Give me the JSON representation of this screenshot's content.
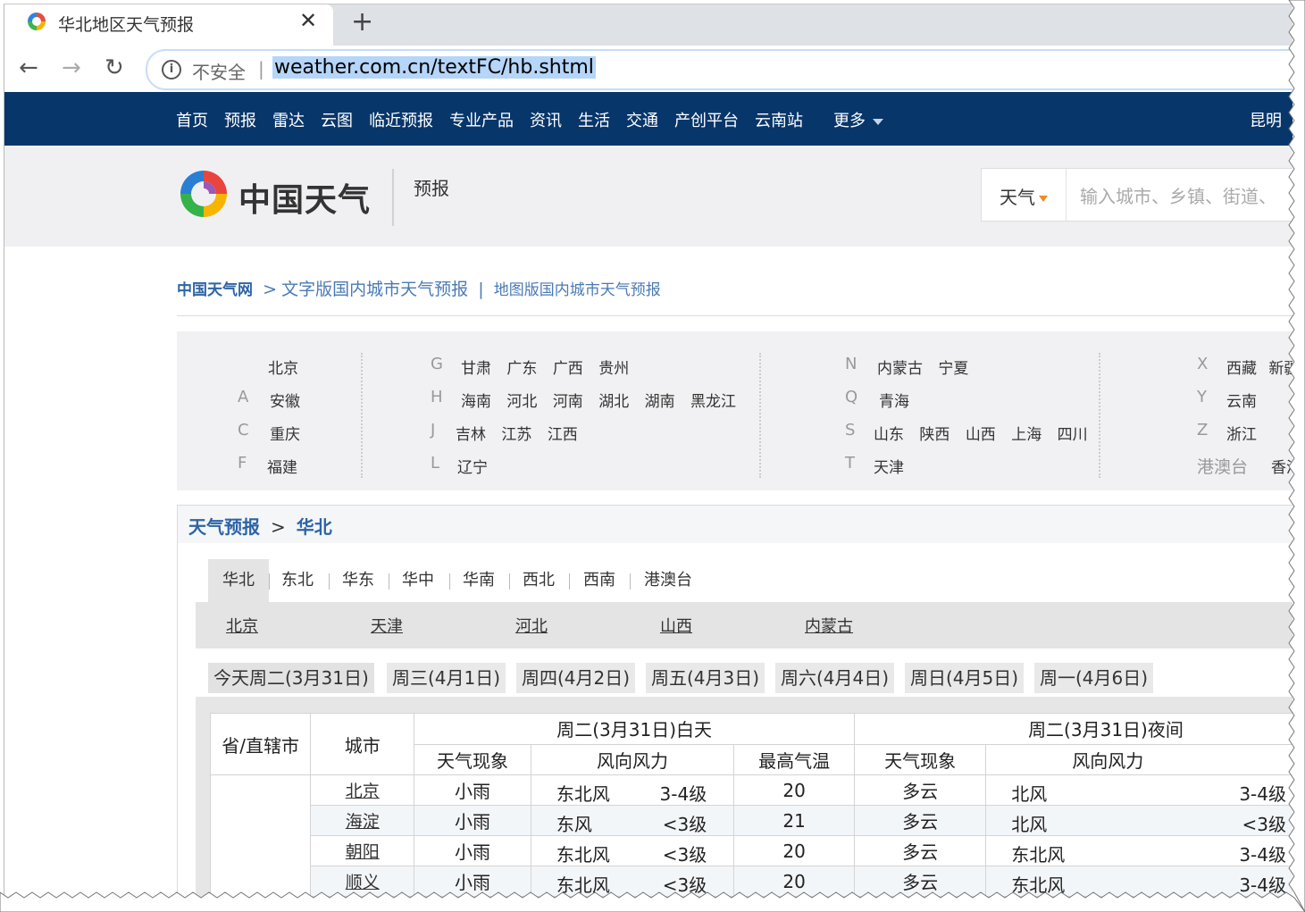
{
  "browser": {
    "tab_title": "华北地区天气预报",
    "close_glyph": "✕",
    "new_tab_glyph": "+",
    "back_glyph": "←",
    "forward_glyph": "→",
    "reload_glyph": "↻",
    "info_glyph": "i",
    "insecure_label": "不安全",
    "separator": "|",
    "url": "weather.com.cn/textFC/hb.shtml"
  },
  "sitenav": {
    "items": [
      "首页",
      "预报",
      "雷达",
      "云图",
      "临近预报",
      "专业产品",
      "资讯",
      "生活",
      "交通",
      "产创平台",
      "云南站"
    ],
    "more": "更多",
    "city": "昆明"
  },
  "header": {
    "logo_text": "中国天气",
    "section": "预报",
    "search_type": "天气",
    "search_placeholder": "输入城市、乡镇、街道、"
  },
  "breadcrumb": {
    "home": "中国天气网",
    "arrow": ">",
    "current": "文字版国内城市天气预报",
    "divider": "|",
    "alt": "地图版国内城市天气预报"
  },
  "provinces": {
    "col1": [
      {
        "letter": "",
        "names": [
          "北京"
        ]
      },
      {
        "letter": "A",
        "names": [
          "安徽"
        ]
      },
      {
        "letter": "C",
        "names": [
          "重庆"
        ]
      },
      {
        "letter": "F",
        "names": [
          "福建"
        ]
      }
    ],
    "col2": [
      {
        "letter": "G",
        "names": [
          "甘肃",
          "广东",
          "广西",
          "贵州"
        ]
      },
      {
        "letter": "H",
        "names": [
          "海南",
          "河北",
          "河南",
          "湖北",
          "湖南",
          "黑龙江"
        ]
      },
      {
        "letter": "J",
        "names": [
          "吉林",
          "江苏",
          "江西"
        ]
      },
      {
        "letter": "L",
        "names": [
          "辽宁"
        ]
      }
    ],
    "col3": [
      {
        "letter": "N",
        "names": [
          "内蒙古",
          "宁夏"
        ]
      },
      {
        "letter": "Q",
        "names": [
          "青海"
        ]
      },
      {
        "letter": "S",
        "names": [
          "山东",
          "陕西",
          "山西",
          "上海",
          "四川"
        ]
      },
      {
        "letter": "T",
        "names": [
          "天津"
        ]
      }
    ],
    "col4": [
      {
        "letter": "X",
        "names": [
          "西藏",
          "新疆"
        ]
      },
      {
        "letter": "Y",
        "names": [
          "云南"
        ]
      },
      {
        "letter": "Z",
        "names": [
          "浙江"
        ]
      },
      {
        "letter": "港澳台",
        "names": [
          "香港"
        ]
      }
    ]
  },
  "forecast": {
    "title": "天气预报",
    "title_sep": ">",
    "title_region": "华北",
    "regions": [
      "华北",
      "东北",
      "华东",
      "华中",
      "华南",
      "西北",
      "西南",
      "港澳台"
    ],
    "cities": [
      "北京",
      "天津",
      "河北",
      "山西",
      "内蒙古"
    ],
    "days": [
      "今天周二(3月31日)",
      "周三(4月1日)",
      "周四(4月2日)",
      "周五(4月3日)",
      "周六(4月4日)",
      "周日(4月5日)",
      "周一(4月6日)"
    ],
    "table": {
      "h_province": "省/直辖市",
      "h_city": "城市",
      "h_day": "周二(3月31日)白天",
      "h_night": "周二(3月31日)夜间",
      "h_weather": "天气现象",
      "h_wind": "风向风力",
      "h_max": "最高气温",
      "h_weather_n": "天气现象",
      "h_wind_n": "风向风力",
      "rows": [
        {
          "city": "北京",
          "weather": "小雨",
          "wind_dir": "东北风",
          "wind_lvl": "3-4级",
          "max": "20",
          "weather_n": "多云",
          "wind_dir_n": "北风",
          "wind_lvl_n": "3-4级"
        },
        {
          "city": "海淀",
          "weather": "小雨",
          "wind_dir": "东风",
          "wind_lvl": "<3级",
          "max": "21",
          "weather_n": "多云",
          "wind_dir_n": "北风",
          "wind_lvl_n": "<3级"
        },
        {
          "city": "朝阳",
          "weather": "小雨",
          "wind_dir": "东北风",
          "wind_lvl": "<3级",
          "max": "20",
          "weather_n": "多云",
          "wind_dir_n": "东北风",
          "wind_lvl_n": "3-4级"
        },
        {
          "city": "顺义",
          "weather": "小雨",
          "wind_dir": "东北风",
          "wind_lvl": "<3级",
          "max": "20",
          "weather_n": "多云",
          "wind_dir_n": "东北风",
          "wind_lvl_n": "3-4级"
        }
      ]
    }
  },
  "colors": {
    "navbar": "#07366a",
    "link": "#2d64a6",
    "search_caret": "#f08a24"
  }
}
